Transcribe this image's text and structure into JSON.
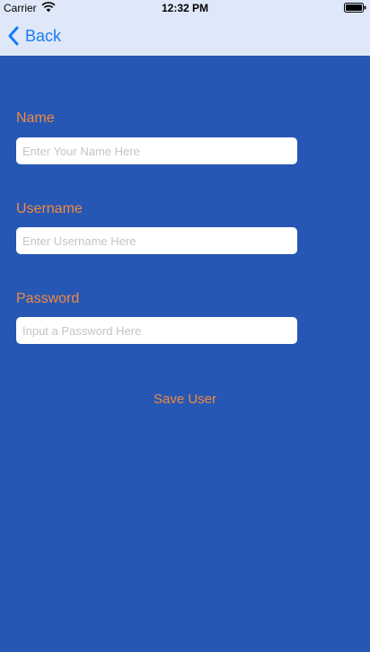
{
  "status_bar": {
    "carrier": "Carrier",
    "time": "12:32 PM",
    "wifi_icon": "wifi-icon",
    "battery_icon": "battery-icon"
  },
  "nav": {
    "back_label": "Back",
    "back_icon": "chevron-left-icon"
  },
  "form": {
    "name": {
      "label": "Name",
      "value": "",
      "placeholder": "Enter Your Name Here"
    },
    "username": {
      "label": "Username",
      "value": "",
      "placeholder": "Enter Username Here"
    },
    "password": {
      "label": "Password",
      "value": "",
      "placeholder": "Input a Password Here"
    },
    "save_label": "Save User"
  },
  "colors": {
    "background": "#2757b5",
    "header_background": "#dfe8f8",
    "accent": "#f08a3c",
    "link": "#1a7cf5"
  }
}
